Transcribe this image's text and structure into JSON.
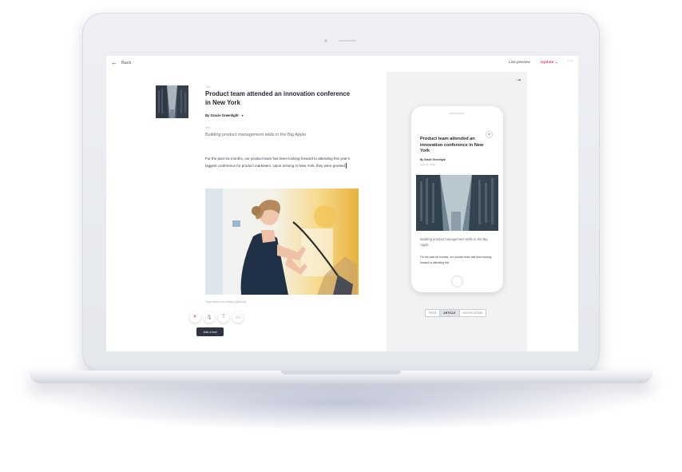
{
  "topbar": {
    "back_label": "Back",
    "live_preview_label": "Live preview",
    "update_label": "Update",
    "update_caret": "⌄",
    "more_label": "···"
  },
  "article": {
    "title_label": "Title",
    "title": "Product team attended an innovation conference in New York",
    "author": "By Gracie Greenlight",
    "author_caret": "▾",
    "subtitle_label": "Intro",
    "subtitle": "Building product management skills in the Big Apple",
    "body": "For the past six months, our product team has been looking forward to attending this year's biggest conference for product marketers. Upon arriving in New York, they were greeted",
    "caption_placeholder": "Type caption for image (optional)"
  },
  "toolbar": {
    "close_icon": "×",
    "mic_icon": "🎙",
    "text_icon": "T",
    "video_icon": "▭",
    "tooltip": "Add a text"
  },
  "preview": {
    "collapse_icon": "⇥",
    "phone_close": "×",
    "title": "Product team attended an innovation conference in New York",
    "author": "By Gracie Greenlight",
    "date": "June 11, 2019",
    "subtitle": "Building product management skills in the Big Apple",
    "body": "For the past six months, our product team has been looking forward to attending this",
    "tabs": [
      "FEED",
      "ARTICLE",
      "NOTIFICATION"
    ],
    "active_tab": "ARTICLE"
  },
  "colors": {
    "accent": "#e6456c",
    "title": "#1f2430",
    "preview_bg": "#f1f2f4"
  }
}
